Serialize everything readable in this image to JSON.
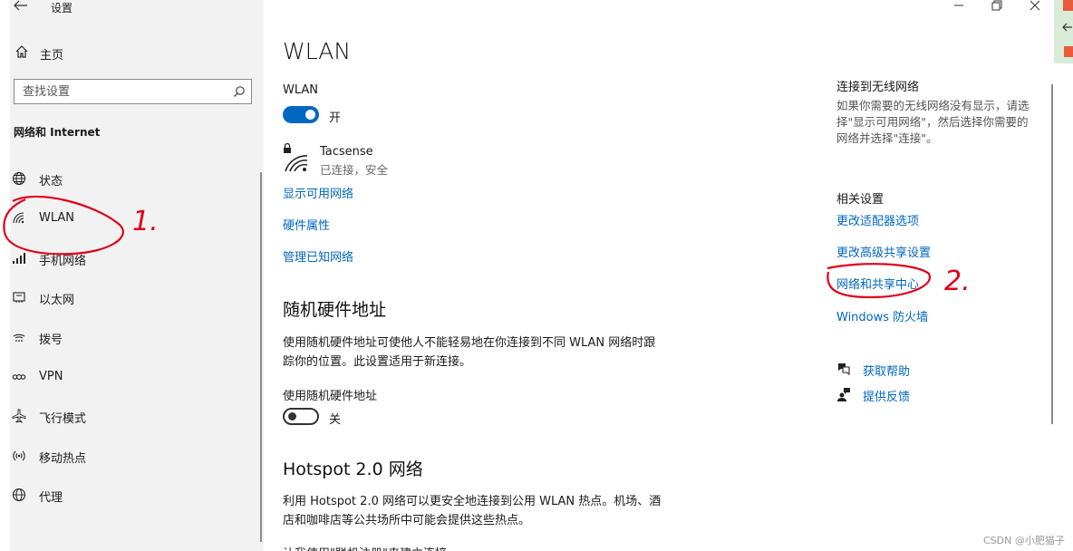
{
  "window": {
    "title": "设置"
  },
  "sidebar": {
    "home": "主页",
    "search_placeholder": "查找设置",
    "section_title": "网络和 Internet",
    "items": [
      {
        "label": "状态",
        "icon": "globe-icon"
      },
      {
        "label": "WLAN",
        "icon": "wifi-icon"
      },
      {
        "label": "手机网络",
        "icon": "cellular-signal-icon"
      },
      {
        "label": "以太网",
        "icon": "ethernet-icon"
      },
      {
        "label": "拨号",
        "icon": "dialup-icon"
      },
      {
        "label": "VPN",
        "icon": "vpn-icon"
      },
      {
        "label": "飞行模式",
        "icon": "airplane-icon"
      },
      {
        "label": "移动热点",
        "icon": "hotspot-icon"
      },
      {
        "label": "代理",
        "icon": "proxy-globe-icon"
      }
    ]
  },
  "main": {
    "title": "WLAN",
    "wlan_label": "WLAN",
    "wlan_state": "开",
    "network": {
      "name": "Tacsense",
      "status": "已连接，安全"
    },
    "links": [
      "显示可用网络",
      "硬件属性",
      "管理已知网络"
    ],
    "random_hw": {
      "title": "随机硬件地址",
      "desc_line1": "使用随机硬件地址可使他人不能轻易地在你连接到不同 WLAN 网络时跟",
      "desc_line2": "踪你的位置。此设置适用于新连接。",
      "toggle_label": "使用随机硬件地址",
      "toggle_state": "关"
    },
    "hotspot": {
      "title": "Hotspot 2.0 网络",
      "desc_line1": "利用 Hotspot 2.0 网络可以更安全地连接到公用 WLAN 热点。机场、酒",
      "desc_line2": "店和咖啡店等公共场所中可能会提供这些热点。",
      "cut_line": "让我使用\"联机注册\"来建立连接"
    }
  },
  "right": {
    "connect_title": "连接到无线网络",
    "connect_desc_1": "如果你需要的无线网络没有显示，请选",
    "connect_desc_2": "择\"显示可用网络\"，然后选择你需要的",
    "connect_desc_3": "网络并选择\"连接\"。",
    "related_title": "相关设置",
    "related_links": [
      "更改适配器选项",
      "更改高级共享设置",
      "网络和共享中心",
      "Windows 防火墙"
    ],
    "help": "获取帮助",
    "feedback": "提供反馈"
  },
  "annotations": {
    "mark1": "1.",
    "mark2": "2."
  },
  "watermark": "CSDN @小肥猫子",
  "colors": {
    "accent": "#0067c0",
    "sidebar_bg": "#f2f2f2",
    "annotation": "#e0001b"
  }
}
